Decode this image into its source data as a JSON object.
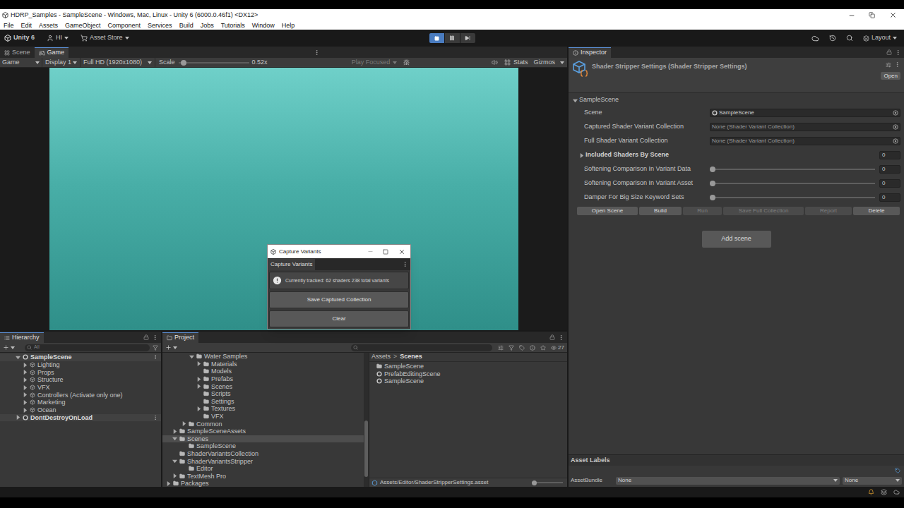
{
  "window": {
    "title": "HDRP_Samples - SampleScene - Windows, Mac, Linux - Unity 6 (6000.0.46f1) <DX12>"
  },
  "menu": [
    "File",
    "Edit",
    "Assets",
    "GameObject",
    "Component",
    "Services",
    "Build",
    "Jobs",
    "Tutorials",
    "Window",
    "Help"
  ],
  "toolbar": {
    "product": "Unity 6",
    "account": "HI",
    "store": "Asset Store",
    "layout": "Layout",
    "playing": true,
    "paused": false
  },
  "view_tabs": [
    {
      "label": "Scene",
      "selected": false
    },
    {
      "label": "Game",
      "selected": true
    }
  ],
  "game_bar": {
    "mode": "Game",
    "display": "Display 1",
    "resolution": "Full HD (1920x1080)",
    "scale_label": "Scale",
    "scale_level": 0.04,
    "scale": "0.52x",
    "play_focused": "Play Focused",
    "stats": "Stats",
    "gizmos": "Gizmos"
  },
  "capture_window": {
    "title": "Capture Variants",
    "tab": "Capture Variants",
    "message": "Currently tracked: 62 shaders 238 total variants",
    "buttons": [
      "Save Captured Collection",
      "Clear"
    ]
  },
  "hierarchy": {
    "title": "Hierarchy",
    "search": "All",
    "items": [
      {
        "label": "SampleScene",
        "kind": "scene",
        "depth": 0,
        "expanded": true
      },
      {
        "label": "Lighting",
        "kind": "object",
        "depth": 1,
        "expanded": false
      },
      {
        "label": "Props",
        "kind": "object",
        "depth": 1,
        "expanded": false
      },
      {
        "label": "Structure",
        "kind": "object",
        "depth": 1,
        "expanded": false
      },
      {
        "label": "VFX",
        "kind": "object",
        "depth": 1,
        "expanded": false
      },
      {
        "label": "Controllers (Activate only one)",
        "kind": "object",
        "depth": 1,
        "expanded": false
      },
      {
        "label": "Marketing",
        "kind": "object",
        "depth": 1,
        "expanded": false
      },
      {
        "label": "Ocean",
        "kind": "object",
        "depth": 1,
        "expanded": false
      },
      {
        "label": "DontDestroyOnLoad",
        "kind": "scene",
        "depth": 0,
        "expanded": false
      }
    ]
  },
  "project": {
    "title": "Project",
    "count": "27",
    "tree": [
      {
        "label": "Water Samples",
        "depth": 3,
        "has_children": true,
        "expanded": true,
        "selected": false
      },
      {
        "label": "Materials",
        "depth": 4,
        "has_children": true,
        "expanded": false,
        "selected": false
      },
      {
        "label": "Models",
        "depth": 4,
        "has_children": false,
        "expanded": false,
        "selected": false
      },
      {
        "label": "Prefabs",
        "depth": 4,
        "has_children": true,
        "expanded": false,
        "selected": false
      },
      {
        "label": "Scenes",
        "depth": 4,
        "has_children": true,
        "expanded": false,
        "selected": false
      },
      {
        "label": "Scripts",
        "depth": 4,
        "has_children": false,
        "expanded": false,
        "selected": false
      },
      {
        "label": "Settings",
        "depth": 4,
        "has_children": false,
        "expanded": false,
        "selected": false
      },
      {
        "label": "Textures",
        "depth": 4,
        "has_children": true,
        "expanded": false,
        "selected": false
      },
      {
        "label": "VFX",
        "depth": 4,
        "has_children": false,
        "expanded": false,
        "selected": false
      },
      {
        "label": "Common",
        "depth": 2,
        "has_children": true,
        "expanded": false,
        "selected": false
      },
      {
        "label": "SampleSceneAssets",
        "depth": 1,
        "has_children": true,
        "expanded": false,
        "selected": false
      },
      {
        "label": "Scenes",
        "depth": 1,
        "has_children": true,
        "expanded": true,
        "selected": true
      },
      {
        "label": "SampleScene",
        "depth": 2,
        "has_children": false,
        "expanded": false,
        "selected": false
      },
      {
        "label": "ShaderVariantsCollection",
        "depth": 1,
        "has_children": false,
        "expanded": false,
        "selected": false
      },
      {
        "label": "ShaderVariantsStripper",
        "depth": 1,
        "has_children": true,
        "expanded": true,
        "selected": false
      },
      {
        "label": "Editor",
        "depth": 2,
        "has_children": false,
        "expanded": false,
        "selected": false
      },
      {
        "label": "TextMesh Pro",
        "depth": 1,
        "has_children": true,
        "expanded": false,
        "selected": false
      },
      {
        "label": "Packages",
        "depth": 0,
        "has_children": true,
        "expanded": false,
        "selected": false
      }
    ],
    "breadcrumb": [
      "Assets",
      "Scenes"
    ],
    "separator": ">",
    "assets": [
      {
        "label": "SampleScene",
        "kind": "folder"
      },
      {
        "label": "PrefabEditingScene",
        "kind": "scene"
      },
      {
        "label": "SampleScene",
        "kind": "scene"
      }
    ],
    "path": "Assets/Editor/ShaderStripperSettings.asset",
    "zoom_level": 0
  },
  "inspector": {
    "title": "Inspector",
    "asset_title": "Shader Stripper Settings (Shader Stripper Settings)",
    "open": "Open",
    "section": {
      "label": "SampleScene",
      "expanded": true
    },
    "fields": [
      {
        "kind": "object",
        "label": "Scene",
        "value": "SampleScene",
        "scene_icon": true
      },
      {
        "kind": "object",
        "label": "Captured Shader Variant Collection",
        "value": "None (Shader Variant Collection)",
        "scene_icon": false
      },
      {
        "kind": "object",
        "label": "Full Shader Variant Collection",
        "value": "None (Shader Variant Collection)",
        "scene_icon": false
      },
      {
        "kind": "foldout",
        "label": "Included Shaders By Scene",
        "expanded": false,
        "value": "0"
      },
      {
        "kind": "slider",
        "label": "Softening Comparison In Variant Data",
        "level": 0,
        "value": "0"
      },
      {
        "kind": "slider",
        "label": "Softening Comparison In Variant Asset",
        "level": 0,
        "value": "0"
      },
      {
        "kind": "slider",
        "label": "Damper For Big Size Keyword Sets",
        "level": 0,
        "value": "0"
      }
    ],
    "actions": [
      {
        "label": "Open Scene",
        "disabled": false
      },
      {
        "label": "Build",
        "disabled": false
      },
      {
        "label": "Run",
        "disabled": true
      },
      {
        "label": "Save Full Collection",
        "disabled": true
      },
      {
        "label": "Report",
        "disabled": true
      },
      {
        "label": "Delete",
        "disabled": false
      }
    ],
    "add_button": "Add scene",
    "labels_title": "Asset Labels",
    "bundle": {
      "label": "AssetBundle",
      "name": "None",
      "variant": "None"
    }
  }
}
